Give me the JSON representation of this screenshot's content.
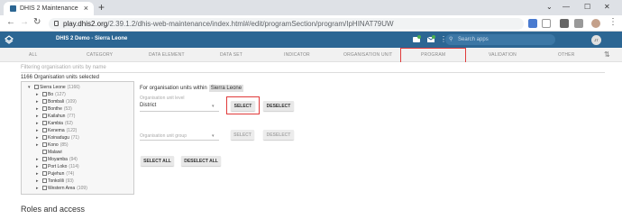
{
  "browser": {
    "tab_title": "DHIS 2 Maintenance",
    "url_host": "play.dhis2.org",
    "url_path": "/2.39.1.2/dhis-web-maintenance/index.html#/edit/programSection/program/IpHINAT79UW"
  },
  "header": {
    "title": "DHIS 2 Demo - Sierra Leone",
    "search_placeholder": "Search apps",
    "avatar_initials": "JT"
  },
  "section_tabs": [
    "ALL",
    "CATEGORY",
    "DATA ELEMENT",
    "DATA SET",
    "INDICATOR",
    "ORGANISATION UNIT",
    "PROGRAM",
    "VALIDATION",
    "OTHER"
  ],
  "org_units": {
    "filter_placeholder": "Filtering organisation units by name",
    "selected_count": "1166 Organisation units selected",
    "tree": [
      {
        "label": "Sierra Leone",
        "count": "(1166)"
      },
      {
        "label": "Bo",
        "count": "(127)"
      },
      {
        "label": "Bombali",
        "count": "(109)"
      },
      {
        "label": "Bonthe",
        "count": "(53)"
      },
      {
        "label": "Kailahun",
        "count": "(77)"
      },
      {
        "label": "Kambia",
        "count": "(62)"
      },
      {
        "label": "Kenema",
        "count": "(122)"
      },
      {
        "label": "Koinadugu",
        "count": "(71)"
      },
      {
        "label": "Kono",
        "count": "(85)"
      },
      {
        "label": "Malawi",
        "count": ""
      },
      {
        "label": "Moyamba",
        "count": "(94)"
      },
      {
        "label": "Port Loko",
        "count": "(114)"
      },
      {
        "label": "Pujehun",
        "count": "(74)"
      },
      {
        "label": "Tonkolili",
        "count": "(93)"
      },
      {
        "label": "Western Area",
        "count": "(109)"
      }
    ],
    "within_label": "For organisation units within",
    "within_value": "Sierra Leone",
    "level_label": "Organisation unit level",
    "level_value": "District",
    "group_label": "Organisation unit group",
    "select_label": "SELECT",
    "deselect_label": "DESELECT",
    "select_all_label": "SELECT ALL",
    "deselect_all_label": "DESELECT ALL"
  },
  "roles_heading": "Roles and access",
  "colors": {
    "brand": "#2c6693",
    "highlight": "#e03a3a"
  }
}
